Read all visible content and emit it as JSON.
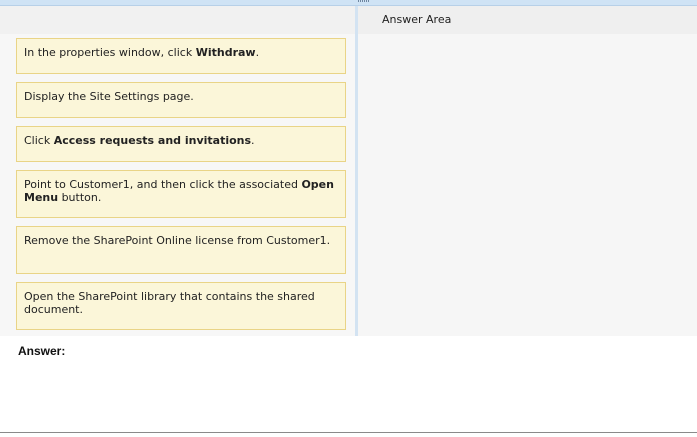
{
  "answer_area": {
    "title": "Answer Area"
  },
  "steps": [
    {
      "parts": [
        {
          "text": "In the properties window, click "
        },
        {
          "text": "Withdraw",
          "bold": true
        },
        {
          "text": "."
        }
      ]
    },
    {
      "parts": [
        {
          "text": "Display the Site Settings page."
        }
      ]
    },
    {
      "parts": [
        {
          "text": "Click "
        },
        {
          "text": "Access requests and invitations",
          "bold": true
        },
        {
          "text": "."
        }
      ]
    },
    {
      "parts": [
        {
          "text": "Point to Customer1, and then click the associated "
        },
        {
          "text": "Open Menu",
          "bold": true
        },
        {
          "text": " button."
        }
      ]
    },
    {
      "parts": [
        {
          "text": "Remove the SharePoint Online license from Customer1."
        }
      ]
    },
    {
      "parts": [
        {
          "text": "Open the SharePoint library that contains the shared document."
        }
      ]
    }
  ],
  "answer_label": "Answer:",
  "icons": {
    "splitter": "grip-dots-icon"
  }
}
